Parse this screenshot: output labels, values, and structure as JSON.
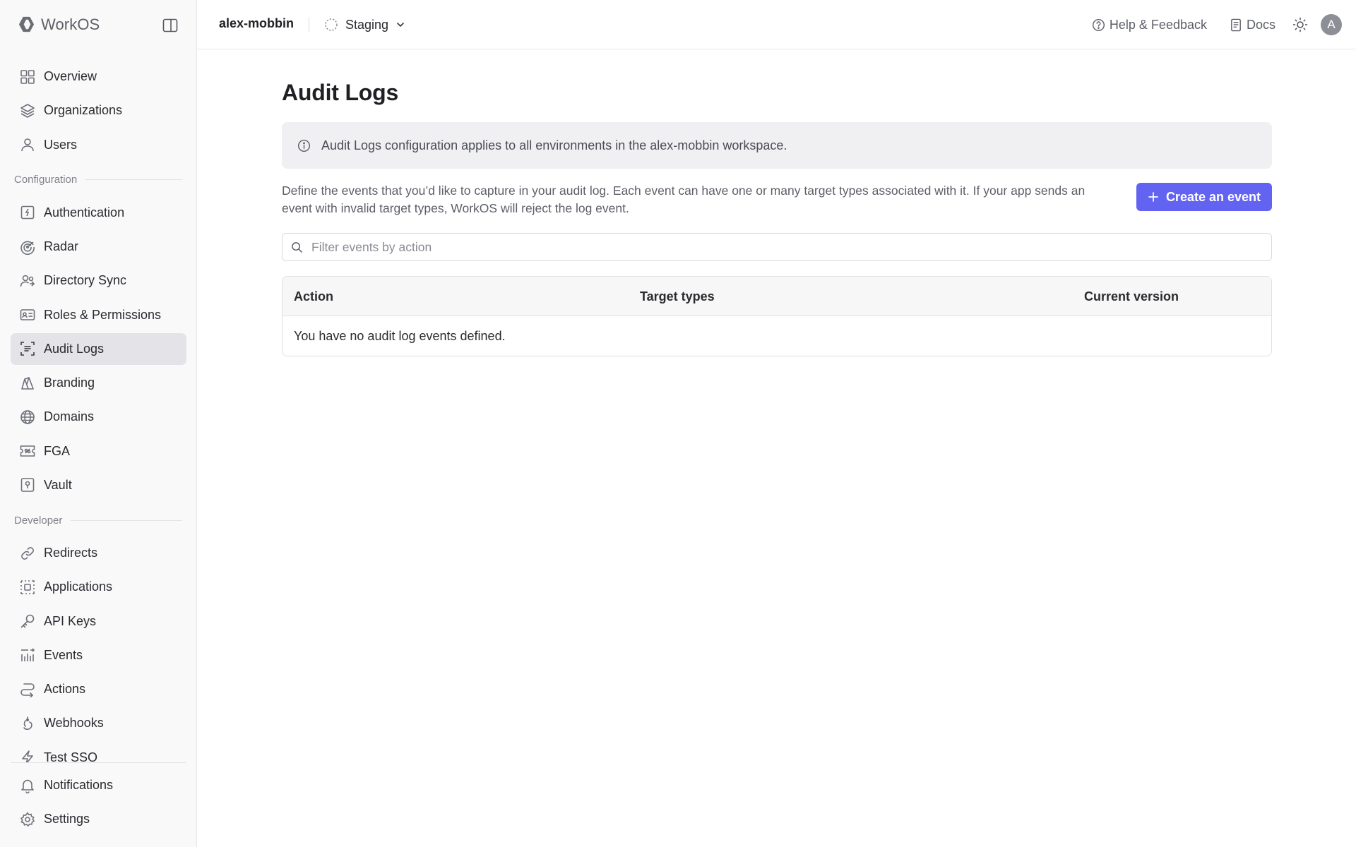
{
  "brand": {
    "name": "WorkOS"
  },
  "topbar": {
    "workspace": "alex-mobbin",
    "environment": "Staging",
    "help_label": "Help & Feedback",
    "docs_label": "Docs",
    "avatar_initial": "A"
  },
  "sidebar": {
    "primary": [
      {
        "label": "Overview",
        "icon": "grid-icon"
      },
      {
        "label": "Organizations",
        "icon": "layers-icon"
      },
      {
        "label": "Users",
        "icon": "user-icon"
      }
    ],
    "configuration_label": "Configuration",
    "configuration": [
      {
        "label": "Authentication",
        "icon": "auth-icon"
      },
      {
        "label": "Radar",
        "icon": "radar-icon"
      },
      {
        "label": "Directory Sync",
        "icon": "users-sync-icon"
      },
      {
        "label": "Roles & Permissions",
        "icon": "id-card-icon"
      },
      {
        "label": "Audit Logs",
        "icon": "audit-log-icon",
        "active": true
      },
      {
        "label": "Branding",
        "icon": "brush-icon"
      },
      {
        "label": "Domains",
        "icon": "globe-icon"
      },
      {
        "label": "FGA",
        "icon": "ticket-icon"
      },
      {
        "label": "Vault",
        "icon": "vault-icon"
      }
    ],
    "developer_label": "Developer",
    "developer": [
      {
        "label": "Redirects",
        "icon": "link-icon"
      },
      {
        "label": "Applications",
        "icon": "app-frame-icon"
      },
      {
        "label": "API Keys",
        "icon": "key-icon"
      },
      {
        "label": "Events",
        "icon": "bar-chart-icon"
      },
      {
        "label": "Actions",
        "icon": "actions-icon"
      },
      {
        "label": "Webhooks",
        "icon": "webhook-icon"
      },
      {
        "label": "Test SSO",
        "icon": "bolt-icon"
      }
    ],
    "bottom": [
      {
        "label": "Notifications",
        "icon": "bell-icon"
      },
      {
        "label": "Settings",
        "icon": "gear-icon"
      }
    ]
  },
  "main": {
    "title": "Audit Logs",
    "banner": "Audit Logs configuration applies to all environments in the alex-mobbin workspace.",
    "description": "Define the events that you’d like to capture in your audit log. Each event can have one or many target types associated with it. If your app sends an event with invalid target types, WorkOS will reject the log event.",
    "create_button": "Create an event",
    "filter_placeholder": "Filter events by action",
    "table": {
      "columns": [
        "Action",
        "Target types",
        "Current version"
      ],
      "empty_text": "You have no audit log events defined."
    }
  },
  "colors": {
    "accent": "#6363f1",
    "sidebar_bg": "#f9f9fa",
    "active_bg": "#e4e4e8",
    "banner_bg": "#f0f0f2"
  }
}
